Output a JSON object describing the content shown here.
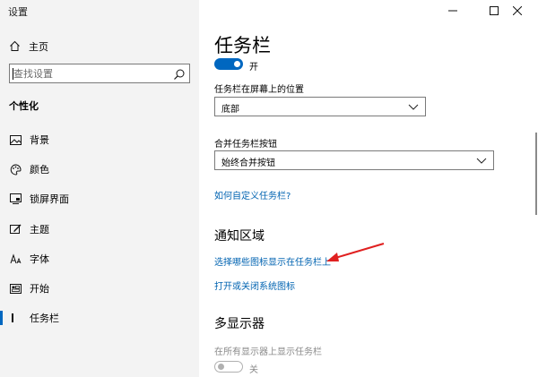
{
  "window": {
    "title": "设置",
    "controls": [
      "minimize",
      "maximize",
      "close"
    ]
  },
  "sidebar": {
    "home_label": "主页",
    "search_placeholder": "查找设置",
    "section_title": "个性化",
    "items": [
      {
        "label": "背景",
        "icon": "picture-icon"
      },
      {
        "label": "颜色",
        "icon": "palette-icon"
      },
      {
        "label": "锁屏界面",
        "icon": "lock-screen-icon"
      },
      {
        "label": "主题",
        "icon": "theme-brush-icon"
      },
      {
        "label": "字体",
        "icon": "font-icon"
      },
      {
        "label": "开始",
        "icon": "start-icon"
      },
      {
        "label": "任务栏",
        "icon": "taskbar-icon",
        "active": true
      }
    ]
  },
  "main": {
    "title": "任务栏",
    "toggle_top": {
      "state": "开",
      "on": true
    },
    "position": {
      "label": "任务栏在屏幕上的位置",
      "value": "底部"
    },
    "combine": {
      "label": "合并任务栏按钮",
      "value": "始终合并按钮"
    },
    "customize_link": "如何自定义任务栏?",
    "notification_heading": "通知区域",
    "notification_links": [
      "选择哪些图标显示在任务栏上",
      "打开或关闭系统图标"
    ],
    "multi_display_heading": "多显示器",
    "multi_display": {
      "label": "在所有显示器上显示任务栏",
      "state": "关",
      "on": false
    }
  },
  "colors": {
    "accent": "#0067c0",
    "link": "#0063b1",
    "annotation_arrow": "#e02020"
  }
}
